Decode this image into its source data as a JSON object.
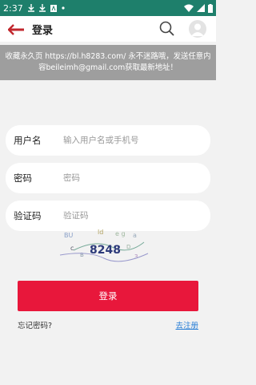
{
  "status_bar": {
    "time": "2:37",
    "icons": [
      "download-icon",
      "download-icon",
      "text-icon",
      "dot-icon",
      "wifi-icon",
      "signal-icon",
      "battery-icon"
    ]
  },
  "header": {
    "title": "登录",
    "back_icon": "back-arrow-icon",
    "search_icon": "search-icon",
    "avatar_icon": "user-avatar-icon"
  },
  "notice": {
    "text": "收藏永久页 https://bl.h8283.com/ 永不迷路哦，发送任意内容beileimh@gmail.com获取最新地址！"
  },
  "form": {
    "username_label": "用户名",
    "username_placeholder": "输入用户名或手机号",
    "password_label": "密码",
    "password_placeholder": "密码",
    "captcha_label": "验证码",
    "captcha_placeholder": "验证码",
    "captcha_text": "8248"
  },
  "actions": {
    "login_label": "登录",
    "forgot_label": "忘记密码?",
    "register_label": "去注册"
  },
  "colors": {
    "status_bar": "#1e7f6b",
    "accent_red": "#e8173b",
    "notice_bg": "#9e9e9e",
    "link_blue": "#2a7fd6"
  }
}
